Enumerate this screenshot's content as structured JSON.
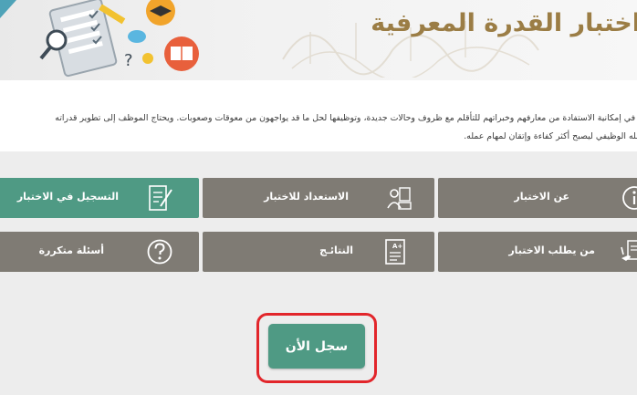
{
  "header": {
    "title": "اختبار القدرة المعرفية"
  },
  "intro": {
    "line1": "ناس في إمكانية الاستفادة من معارفهم وخبراتهم للتأقلم مع ظروف وحالات جديدة، وتوظيفها لحل ما قد يواجهون من معوقات وصعوبات. ويحتاج الموظف إلى تطوير قدراته",
    "line2": "ه عمله الوظيفي ليصبح أكثر كفاءة وإتقان لمهام عمله."
  },
  "tiles": {
    "register": "التسجيل في الاختبار",
    "preparation": "الاستعداد للاختبار",
    "about": "عن الاختبار",
    "faq": "أسئلة متكررة",
    "results": "النتائـج",
    "who": "من يطلب الاختبار"
  },
  "cta": {
    "label": "سجل الأن"
  },
  "colors": {
    "brand_gold": "#9b7d45",
    "tile_gray": "#7f7b74",
    "tile_green": "#4f9a84",
    "highlight_red": "#e2262b"
  },
  "icons": {
    "register": "form-pen-icon",
    "preparation": "study-person-icon",
    "about": "info-icon",
    "faq": "question-icon",
    "results": "grade-sheet-icon",
    "who": "document-hand-icon"
  }
}
